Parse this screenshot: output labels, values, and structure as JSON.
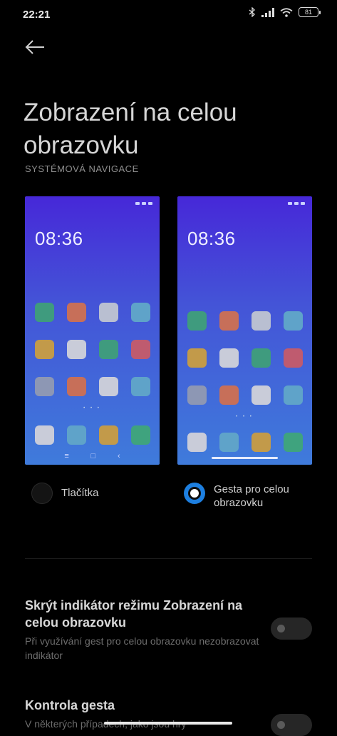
{
  "status": {
    "time": "22:21",
    "battery": "81",
    "icons": [
      "bluetooth-icon",
      "signal-icon",
      "wifi-icon",
      "battery-icon"
    ]
  },
  "page": {
    "title": "Zobrazení na celou obrazovku",
    "section_header": "SYSTÉMOVÁ NAVIGACE"
  },
  "previews": {
    "left": {
      "time": "08:36",
      "nav": [
        "≡",
        "□",
        "‹"
      ]
    },
    "right": {
      "time": "08:36"
    },
    "app_colors": [
      [
        "#3f9b7e",
        "#c76f59",
        "#b9bfd1",
        "#5fa3c9"
      ],
      [
        "#c29a4a",
        "#c9ccd9",
        "#3f9b7e",
        "#bf5b6f"
      ],
      [
        "#8d97b4",
        "#c76f59",
        "#c9ccd9",
        "#5fa3c9"
      ]
    ],
    "dock_colors": [
      "#c9ccd9",
      "#5fa3c9",
      "#c29a4a",
      "#3fa37e"
    ]
  },
  "options": {
    "buttons_label": "Tlačítka",
    "gestures_label": "Gesta pro celou obrazovku",
    "selected": "gestures"
  },
  "settings": [
    {
      "title": "Skrýt indikátor režimu Zobrazení na celou obrazovku",
      "description": "Při využívání gest pro celou obrazovku nezobrazovat indikátor",
      "enabled": false
    },
    {
      "title": "Kontrola gesta",
      "description": "V některých případech, jako jsou hry",
      "enabled": false
    }
  ],
  "colors": {
    "accent": "#1d7fe0",
    "background": "#000000"
  }
}
